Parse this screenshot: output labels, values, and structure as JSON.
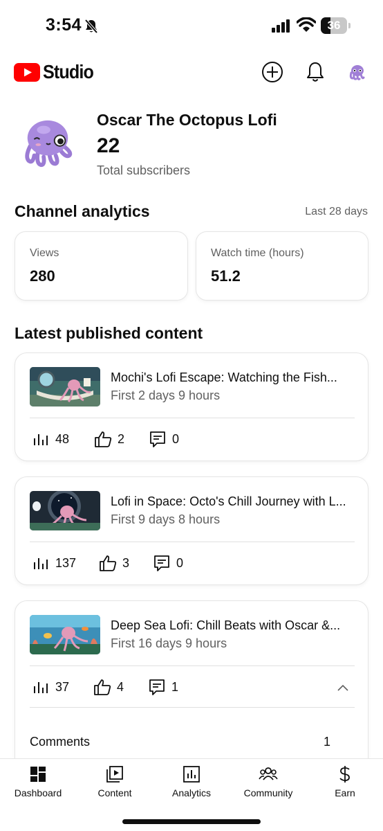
{
  "status_bar": {
    "time": "3:54",
    "battery": "36",
    "battery_level": 0.36,
    "icons": [
      "bell-slash-icon",
      "cellular-signal-icon",
      "wifi-icon",
      "battery-icon"
    ]
  },
  "header": {
    "logo_text": "Studio",
    "brand_color": "#FF0000",
    "icons": [
      "create-icon",
      "notifications-icon",
      "account-avatar"
    ]
  },
  "channel": {
    "name": "Oscar The Octopus Lofi",
    "subscriber_count": "22",
    "subscriber_label": "Total subscribers"
  },
  "analytics": {
    "title": "Channel analytics",
    "range": "Last 28 days",
    "stats": [
      {
        "label": "Views",
        "value": "280"
      },
      {
        "label": "Watch time (hours)",
        "value": "51.2"
      }
    ]
  },
  "latest": {
    "title": "Latest published content",
    "videos": [
      {
        "title": "Mochi's Lofi Escape: Watching the Fish...",
        "subtitle": "First 2 days 9 hours",
        "views": "48",
        "likes": "2",
        "comments": "0"
      },
      {
        "title": "Lofi in Space: Octo's Chill Journey with L...",
        "subtitle": "First 9 days 8 hours",
        "views": "137",
        "likes": "3",
        "comments": "0"
      },
      {
        "title": "Deep Sea Lofi: Chill Beats with Oscar &...",
        "subtitle": "First 16 days 9 hours",
        "views": "37",
        "likes": "4",
        "comments": "1",
        "expanded": true,
        "comments_label": "Comments",
        "comments_count": "1"
      }
    ]
  },
  "nav": {
    "items": [
      {
        "label": "Dashboard",
        "icon": "dashboard-icon",
        "active": true
      },
      {
        "label": "Content",
        "icon": "content-icon"
      },
      {
        "label": "Analytics",
        "icon": "analytics-icon"
      },
      {
        "label": "Community",
        "icon": "community-icon"
      },
      {
        "label": "Earn",
        "icon": "earn-icon"
      }
    ]
  }
}
